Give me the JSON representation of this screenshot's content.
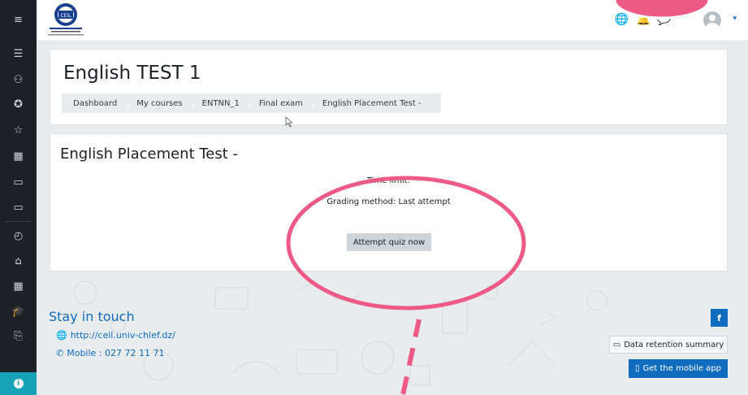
{
  "logo": {
    "text": "CEIL"
  },
  "page": {
    "title": "English TEST 1",
    "breadcrumb": [
      "Dashboard",
      "My courses",
      "ENTNN_1",
      "Final exam",
      "English Placement Test -"
    ]
  },
  "quiz": {
    "title": "English Placement Test -",
    "time_limit": "Time limit:",
    "grading": "Grading method: Last attempt",
    "attempt_label": "Attempt quiz now"
  },
  "footer": {
    "stay": "Stay in touch",
    "url": "http://ceil.univ-chlef.dz/",
    "mobile": "Mobile : 027 72 11 71",
    "fb": "f",
    "retention": "Data retention summary",
    "mobile_app": "Get the mobile app"
  },
  "icons": {
    "menu": "≡",
    "courses": "☰",
    "participants": "⚇",
    "badges": "✪",
    "star": "☆",
    "grades": "▦",
    "folder": "▭",
    "dashboard": "◴",
    "home": "⌂",
    "calendar": "▦",
    "mycourses": "🎓",
    "files": "⎘",
    "globe": "🌐",
    "bell": "🔔",
    "chat": "💬",
    "phone": "✆"
  },
  "colors": {
    "brand": "#0f6cbf",
    "annotation": "#ee5a86",
    "sidebar": "#1d2125"
  }
}
